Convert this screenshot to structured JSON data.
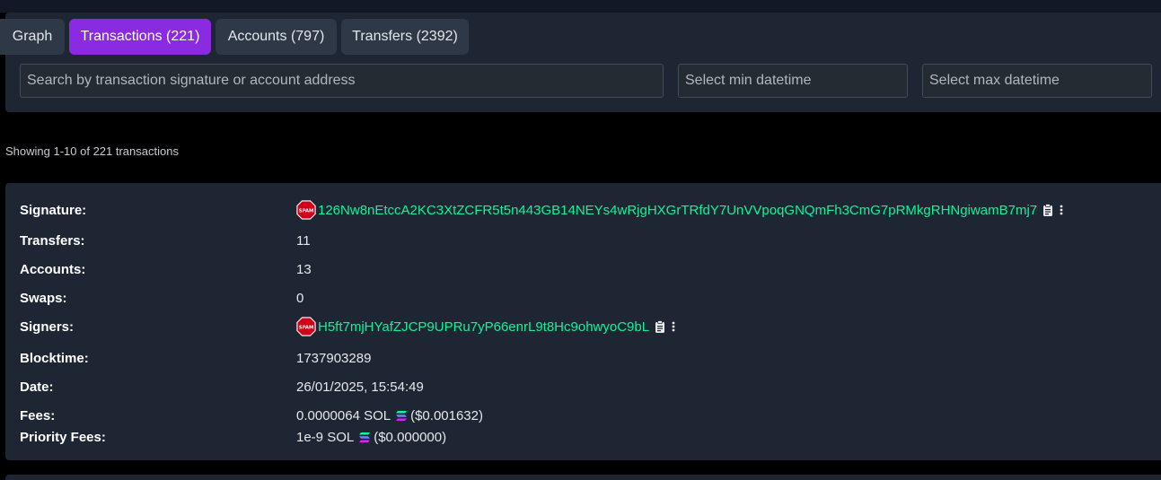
{
  "tabs": [
    {
      "label": "Graph",
      "active": false
    },
    {
      "label": "Transactions (221)",
      "active": true
    },
    {
      "label": "Accounts (797)",
      "active": false
    },
    {
      "label": "Transfers (2392)",
      "active": false
    }
  ],
  "filters": {
    "search_placeholder": "Search by transaction signature or account address",
    "min_placeholder": "Select min datetime",
    "max_placeholder": "Select max datetime"
  },
  "showing_text": "Showing 1-10 of 221 transactions",
  "transaction": {
    "signature_label": "Signature:",
    "signature": "126Nw8nEtccA2KC3XtZCFR5t5n443GB14NEYs4wRjgHXGrTRfdY7UnVVpoqGNQmFh3CmG7pRMkgRHNgiwamB7mj7",
    "transfers_label": "Transfers:",
    "transfers": "11",
    "accounts_label": "Accounts:",
    "accounts": "13",
    "swaps_label": "Swaps:",
    "swaps": "0",
    "signers_label": "Signers:",
    "signer": "H5ft7mjHYafZJCP9UPRu7yP66enrL9t8Hc9ohwyoC9bL",
    "blocktime_label": "Blocktime:",
    "blocktime": "1737903289",
    "date_label": "Date:",
    "date": "26/01/2025, 15:54:49",
    "fees_label": "Fees:",
    "fees": "0.0000064 SOL",
    "fees_usd": "($0.001632)",
    "priority_label": "Priority Fees:",
    "priority": "1e-9 SOL",
    "priority_usd": "($0.000000)"
  },
  "spam_text": "SPAM",
  "icons": {
    "spam": "spam-stop-sign-icon",
    "copy": "clipboard-icon",
    "more": "vertical-ellipsis-icon",
    "sol": "solana-logo-icon"
  },
  "colors": {
    "accent": "#8a2be2",
    "link": "#14f195",
    "spam": "#d0021b"
  }
}
